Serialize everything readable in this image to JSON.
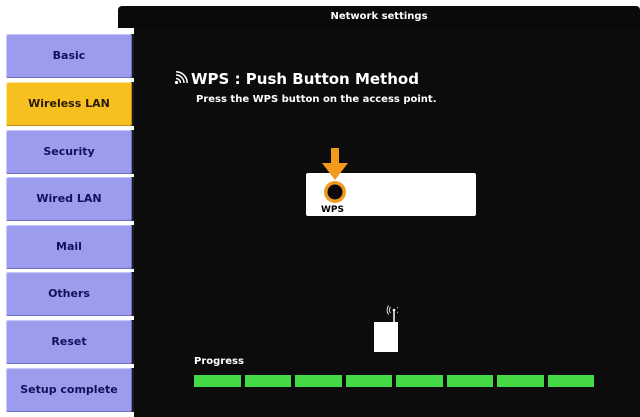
{
  "window": {
    "title": "Network settings"
  },
  "sidebar": {
    "items": [
      {
        "label": "Basic",
        "active": false
      },
      {
        "label": "Wireless LAN",
        "active": true
      },
      {
        "label": "Security",
        "active": false
      },
      {
        "label": "Wired LAN",
        "active": false
      },
      {
        "label": "Mail",
        "active": false
      },
      {
        "label": "Others",
        "active": false
      },
      {
        "label": "Reset",
        "active": false
      },
      {
        "label": "Setup complete",
        "active": false
      }
    ]
  },
  "main": {
    "title": "WPS : Push Button Method",
    "instruction": "Press the WPS button on the access point.",
    "wps_button_label": "WPS",
    "progress_label": "Progress",
    "progress": {
      "segments_total": 8,
      "segments_filled": 8,
      "fraction": 1.0
    }
  },
  "colors": {
    "sidebar_button": "#9c9cee",
    "sidebar_active": "#f6c020",
    "panel_background": "#0c0c0c",
    "progress_fill": "#45d945",
    "arrow": "#f29a1c"
  },
  "icons": {
    "title_icon": "wireless-signal-icon",
    "arrow_icon": "down-arrow-icon",
    "wps_button_icon": "wps-button-icon",
    "device_icon": "wireless-device-icon"
  }
}
